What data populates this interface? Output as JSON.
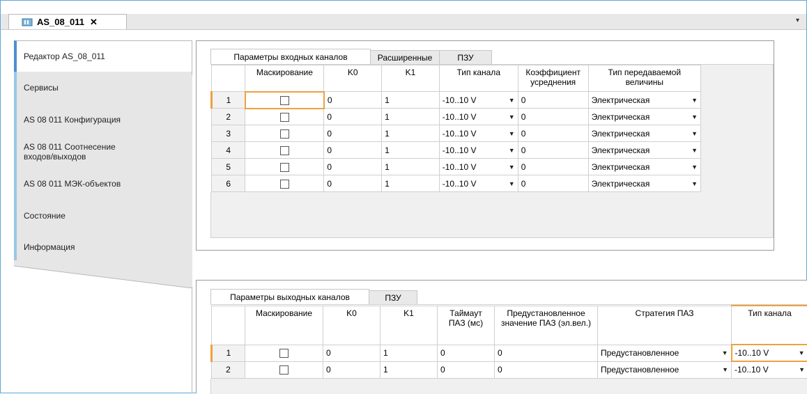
{
  "window": {
    "tab_title": "AS_08_011",
    "tab_close": "✕",
    "strip_chevron": "▾"
  },
  "nav": {
    "items": [
      {
        "label": "Редактор AS_08_011"
      },
      {
        "label": "Сервисы"
      },
      {
        "label": "AS 08 011 Конфигурация"
      },
      {
        "label": "AS 08 011 Соотнесение входов/выходов"
      },
      {
        "label": "AS 08 011 МЭК-объектов"
      },
      {
        "label": "Состояние"
      },
      {
        "label": "Информация"
      }
    ]
  },
  "input_panel": {
    "tabs": [
      "Параметры входных каналов",
      "Расширенные",
      "ПЗУ"
    ],
    "headers": [
      "Маскирование",
      "K0",
      "K1",
      "Тип канала",
      "Коэффициент усреднения",
      "Тип передаваемой величины"
    ],
    "rows": [
      {
        "n": "1",
        "k0": "0",
        "k1": "1",
        "type": "-10..10 V",
        "coef": "0",
        "value_type": "Электрическая"
      },
      {
        "n": "2",
        "k0": "0",
        "k1": "1",
        "type": "-10..10 V",
        "coef": "0",
        "value_type": "Электрическая"
      },
      {
        "n": "3",
        "k0": "0",
        "k1": "1",
        "type": "-10..10 V",
        "coef": "0",
        "value_type": "Электрическая"
      },
      {
        "n": "4",
        "k0": "0",
        "k1": "1",
        "type": "-10..10 V",
        "coef": "0",
        "value_type": "Электрическая"
      },
      {
        "n": "5",
        "k0": "0",
        "k1": "1",
        "type": "-10..10 V",
        "coef": "0",
        "value_type": "Электрическая"
      },
      {
        "n": "6",
        "k0": "0",
        "k1": "1",
        "type": "-10..10 V",
        "coef": "0",
        "value_type": "Электрическая"
      }
    ]
  },
  "output_panel": {
    "tabs": [
      "Параметры выходных каналов",
      "ПЗУ"
    ],
    "headers": [
      "Маскирование",
      "K0",
      "K1",
      "Таймаут ПАЗ (мс)",
      "Предустановленное значение ПАЗ (эл.вел.)",
      "Стратегия ПАЗ",
      "Тип канала"
    ],
    "rows": [
      {
        "n": "1",
        "k0": "0",
        "k1": "1",
        "timeout": "0",
        "preset": "0",
        "strategy": "Предустановленное",
        "type": "-10..10 V"
      },
      {
        "n": "2",
        "k0": "0",
        "k1": "1",
        "timeout": "0",
        "preset": "0",
        "strategy": "Предустановленное",
        "type": "-10..10 V"
      }
    ]
  },
  "icons": {
    "dropdown": "chevron-down-icon",
    "document": "device-icon"
  },
  "colors": {
    "accent": "#f0a040",
    "nav_active": "#4b8fd1",
    "frame": "#5fa8d3"
  }
}
